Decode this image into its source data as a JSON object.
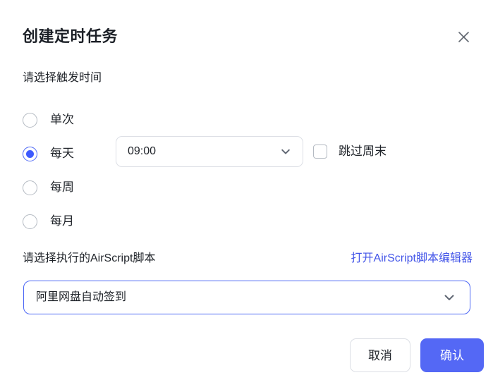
{
  "dialog": {
    "title": "创建定时任务",
    "close_icon": "close-icon"
  },
  "trigger": {
    "label": "请选择触发时间",
    "options": [
      {
        "label": "单次",
        "selected": false
      },
      {
        "label": "每天",
        "selected": true
      },
      {
        "label": "每周",
        "selected": false
      },
      {
        "label": "每月",
        "selected": false
      }
    ],
    "time_select": {
      "value": "09:00",
      "caret_icon": "chevron-down-icon"
    },
    "skip_weekend": {
      "label": "跳过周末",
      "checked": false
    }
  },
  "script": {
    "label": "请选择执行的AirScript脚本",
    "editor_link": "打开AirScript脚本编辑器",
    "select": {
      "value": "阿里网盘自动签到",
      "caret_icon": "chevron-down-icon"
    }
  },
  "footer": {
    "cancel_label": "取消",
    "confirm_label": "确认"
  },
  "colors": {
    "accent": "#3d5afe",
    "confirm_button": "#5468f5",
    "link": "#4355e8",
    "border": "#dcdfe5",
    "text": "#1f2329"
  }
}
